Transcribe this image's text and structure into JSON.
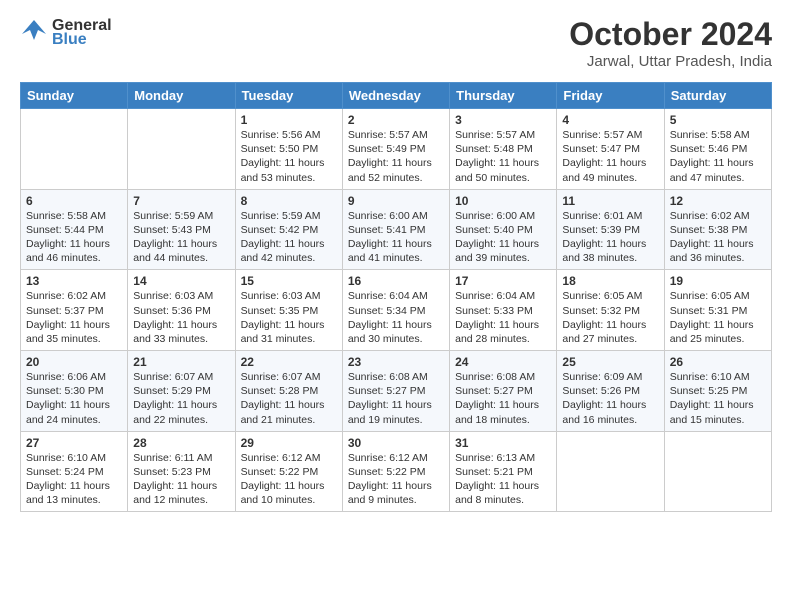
{
  "header": {
    "logo_line1": "General",
    "logo_line2": "Blue",
    "month": "October 2024",
    "location": "Jarwal, Uttar Pradesh, India"
  },
  "weekdays": [
    "Sunday",
    "Monday",
    "Tuesday",
    "Wednesday",
    "Thursday",
    "Friday",
    "Saturday"
  ],
  "weeks": [
    [
      {
        "day": "",
        "info": ""
      },
      {
        "day": "",
        "info": ""
      },
      {
        "day": "1",
        "info": "Sunrise: 5:56 AM\nSunset: 5:50 PM\nDaylight: 11 hours and 53 minutes."
      },
      {
        "day": "2",
        "info": "Sunrise: 5:57 AM\nSunset: 5:49 PM\nDaylight: 11 hours and 52 minutes."
      },
      {
        "day": "3",
        "info": "Sunrise: 5:57 AM\nSunset: 5:48 PM\nDaylight: 11 hours and 50 minutes."
      },
      {
        "day": "4",
        "info": "Sunrise: 5:57 AM\nSunset: 5:47 PM\nDaylight: 11 hours and 49 minutes."
      },
      {
        "day": "5",
        "info": "Sunrise: 5:58 AM\nSunset: 5:46 PM\nDaylight: 11 hours and 47 minutes."
      }
    ],
    [
      {
        "day": "6",
        "info": "Sunrise: 5:58 AM\nSunset: 5:44 PM\nDaylight: 11 hours and 46 minutes."
      },
      {
        "day": "7",
        "info": "Sunrise: 5:59 AM\nSunset: 5:43 PM\nDaylight: 11 hours and 44 minutes."
      },
      {
        "day": "8",
        "info": "Sunrise: 5:59 AM\nSunset: 5:42 PM\nDaylight: 11 hours and 42 minutes."
      },
      {
        "day": "9",
        "info": "Sunrise: 6:00 AM\nSunset: 5:41 PM\nDaylight: 11 hours and 41 minutes."
      },
      {
        "day": "10",
        "info": "Sunrise: 6:00 AM\nSunset: 5:40 PM\nDaylight: 11 hours and 39 minutes."
      },
      {
        "day": "11",
        "info": "Sunrise: 6:01 AM\nSunset: 5:39 PM\nDaylight: 11 hours and 38 minutes."
      },
      {
        "day": "12",
        "info": "Sunrise: 6:02 AM\nSunset: 5:38 PM\nDaylight: 11 hours and 36 minutes."
      }
    ],
    [
      {
        "day": "13",
        "info": "Sunrise: 6:02 AM\nSunset: 5:37 PM\nDaylight: 11 hours and 35 minutes."
      },
      {
        "day": "14",
        "info": "Sunrise: 6:03 AM\nSunset: 5:36 PM\nDaylight: 11 hours and 33 minutes."
      },
      {
        "day": "15",
        "info": "Sunrise: 6:03 AM\nSunset: 5:35 PM\nDaylight: 11 hours and 31 minutes."
      },
      {
        "day": "16",
        "info": "Sunrise: 6:04 AM\nSunset: 5:34 PM\nDaylight: 11 hours and 30 minutes."
      },
      {
        "day": "17",
        "info": "Sunrise: 6:04 AM\nSunset: 5:33 PM\nDaylight: 11 hours and 28 minutes."
      },
      {
        "day": "18",
        "info": "Sunrise: 6:05 AM\nSunset: 5:32 PM\nDaylight: 11 hours and 27 minutes."
      },
      {
        "day": "19",
        "info": "Sunrise: 6:05 AM\nSunset: 5:31 PM\nDaylight: 11 hours and 25 minutes."
      }
    ],
    [
      {
        "day": "20",
        "info": "Sunrise: 6:06 AM\nSunset: 5:30 PM\nDaylight: 11 hours and 24 minutes."
      },
      {
        "day": "21",
        "info": "Sunrise: 6:07 AM\nSunset: 5:29 PM\nDaylight: 11 hours and 22 minutes."
      },
      {
        "day": "22",
        "info": "Sunrise: 6:07 AM\nSunset: 5:28 PM\nDaylight: 11 hours and 21 minutes."
      },
      {
        "day": "23",
        "info": "Sunrise: 6:08 AM\nSunset: 5:27 PM\nDaylight: 11 hours and 19 minutes."
      },
      {
        "day": "24",
        "info": "Sunrise: 6:08 AM\nSunset: 5:27 PM\nDaylight: 11 hours and 18 minutes."
      },
      {
        "day": "25",
        "info": "Sunrise: 6:09 AM\nSunset: 5:26 PM\nDaylight: 11 hours and 16 minutes."
      },
      {
        "day": "26",
        "info": "Sunrise: 6:10 AM\nSunset: 5:25 PM\nDaylight: 11 hours and 15 minutes."
      }
    ],
    [
      {
        "day": "27",
        "info": "Sunrise: 6:10 AM\nSunset: 5:24 PM\nDaylight: 11 hours and 13 minutes."
      },
      {
        "day": "28",
        "info": "Sunrise: 6:11 AM\nSunset: 5:23 PM\nDaylight: 11 hours and 12 minutes."
      },
      {
        "day": "29",
        "info": "Sunrise: 6:12 AM\nSunset: 5:22 PM\nDaylight: 11 hours and 10 minutes."
      },
      {
        "day": "30",
        "info": "Sunrise: 6:12 AM\nSunset: 5:22 PM\nDaylight: 11 hours and 9 minutes."
      },
      {
        "day": "31",
        "info": "Sunrise: 6:13 AM\nSunset: 5:21 PM\nDaylight: 11 hours and 8 minutes."
      },
      {
        "day": "",
        "info": ""
      },
      {
        "day": "",
        "info": ""
      }
    ]
  ]
}
